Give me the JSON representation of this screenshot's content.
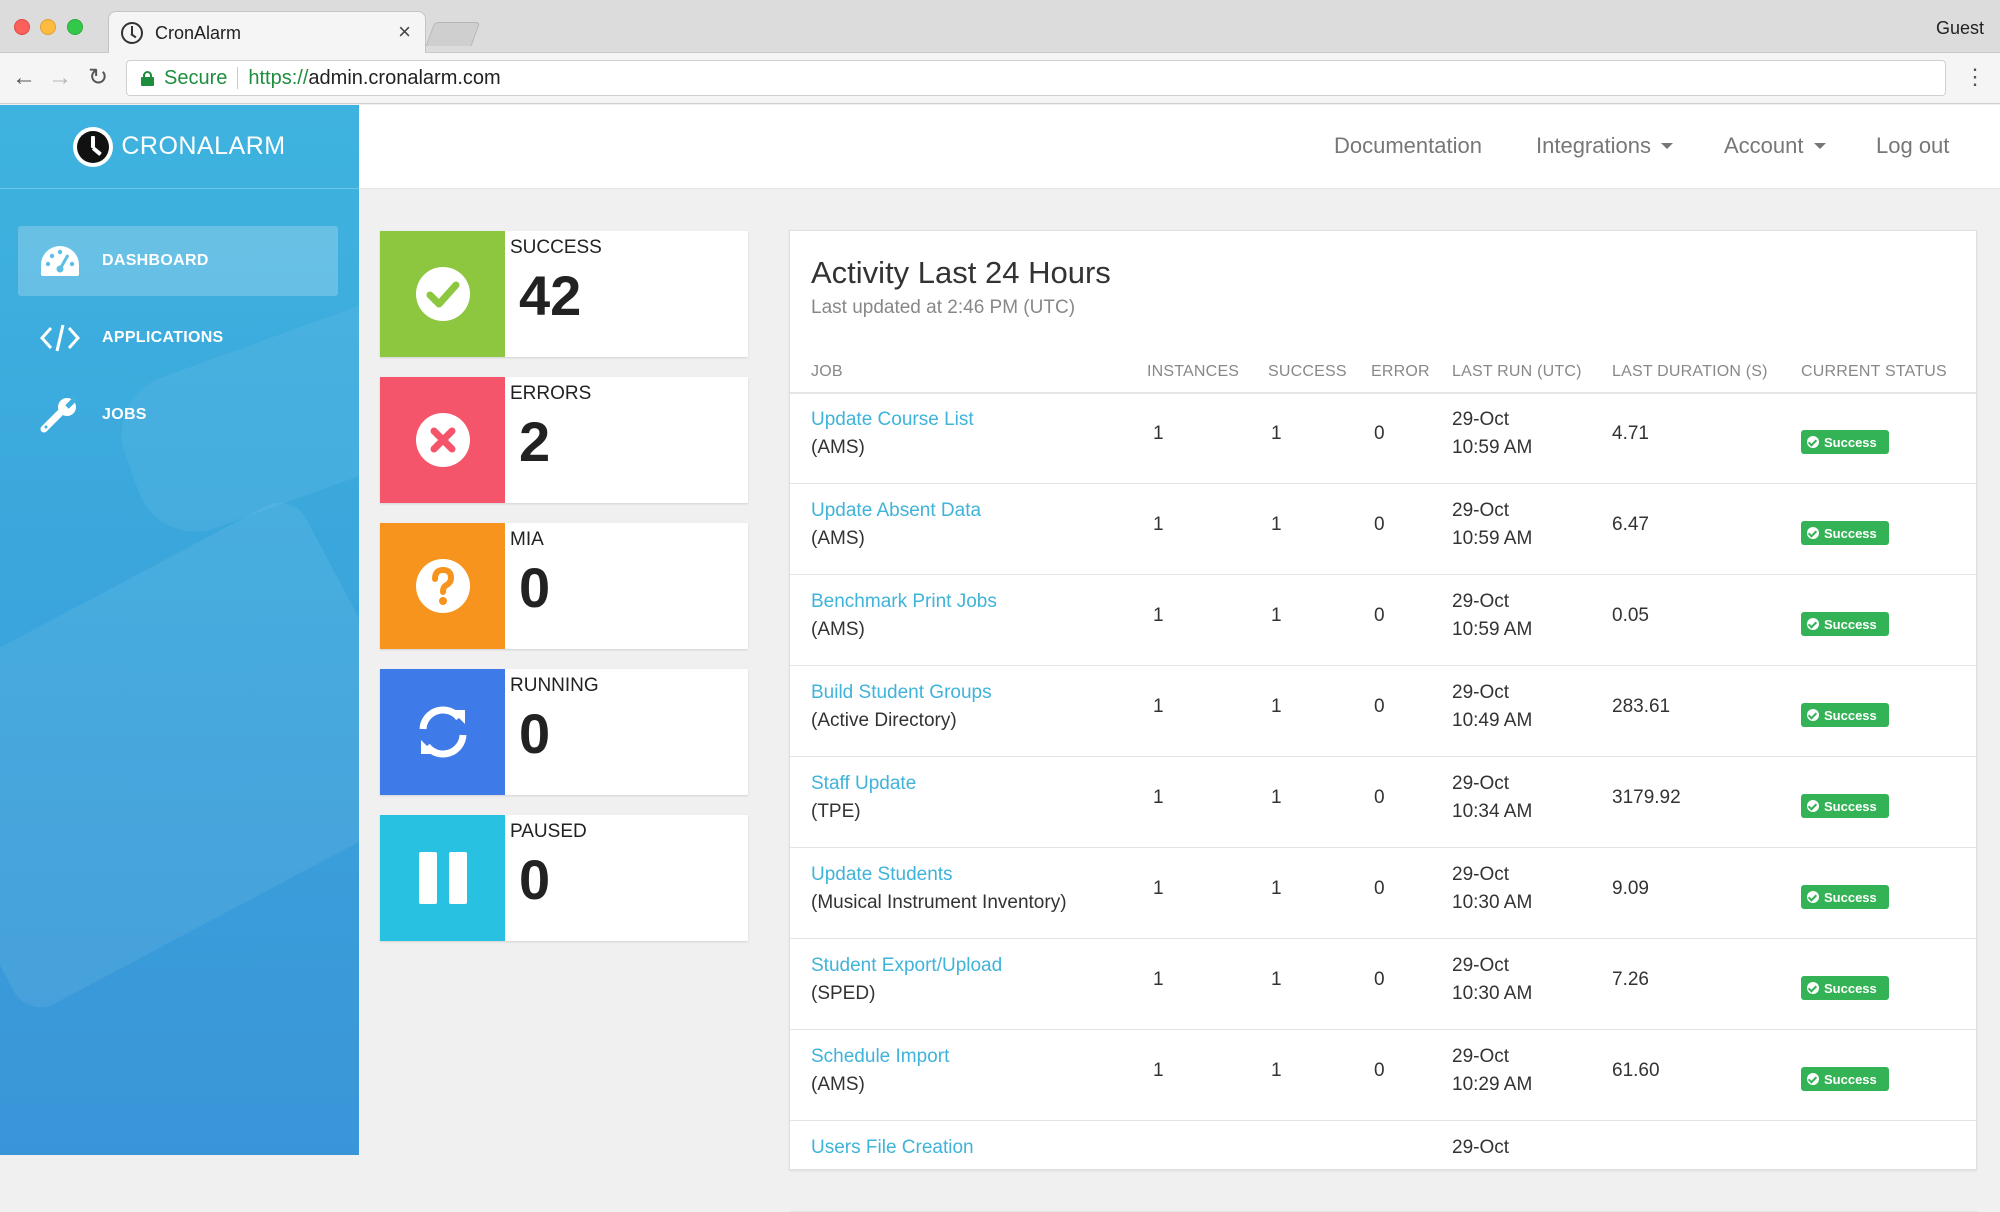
{
  "browser": {
    "tab_title": "CronAlarm",
    "tab_close": "×",
    "profile": "Guest",
    "secure_label": "Secure",
    "url_scheme": "https://",
    "url_host": "admin.cronalarm.com"
  },
  "sidebar": {
    "brand": "CRONALARM",
    "items": [
      {
        "label": "DASHBOARD",
        "icon": "dashboard-icon",
        "active": true
      },
      {
        "label": "APPLICATIONS",
        "icon": "code-icon",
        "active": false
      },
      {
        "label": "JOBS",
        "icon": "wrench-icon",
        "active": false
      }
    ]
  },
  "topnav": {
    "documentation": "Documentation",
    "integrations": "Integrations",
    "account": "Account",
    "logout": "Log out"
  },
  "stats": [
    {
      "label": "SUCCESS",
      "value": "42",
      "color": "#8dc63f",
      "icon": "check-circle-icon"
    },
    {
      "label": "ERRORS",
      "value": "2",
      "color": "#f4556a",
      "icon": "x-circle-icon"
    },
    {
      "label": "MIA",
      "value": "0",
      "color": "#f7941d",
      "icon": "question-circle-icon"
    },
    {
      "label": "RUNNING",
      "value": "0",
      "color": "#3f7be8",
      "icon": "refresh-icon"
    },
    {
      "label": "PAUSED",
      "value": "0",
      "color": "#29c1e1",
      "icon": "pause-icon"
    }
  ],
  "activity": {
    "title": "Activity Last 24 Hours",
    "subtitle": "Last updated at 2:46 PM (UTC)",
    "columns": [
      "JOB",
      "INSTANCES",
      "SUCCESS",
      "ERROR",
      "LAST RUN (UTC)",
      "LAST DURATION (S)",
      "CURRENT STATUS"
    ],
    "rows": [
      {
        "job": "Update Course List",
        "app": "(AMS)",
        "instances": "1",
        "success": "1",
        "error": "0",
        "date": "29-Oct",
        "time": "10:59 AM",
        "duration": "4.71",
        "status": "Success"
      },
      {
        "job": "Update Absent Data",
        "app": "(AMS)",
        "instances": "1",
        "success": "1",
        "error": "0",
        "date": "29-Oct",
        "time": "10:59 AM",
        "duration": "6.47",
        "status": "Success"
      },
      {
        "job": "Benchmark Print Jobs",
        "app": "(AMS)",
        "instances": "1",
        "success": "1",
        "error": "0",
        "date": "29-Oct",
        "time": "10:59 AM",
        "duration": "0.05",
        "status": "Success"
      },
      {
        "job": "Build Student Groups",
        "app": "(Active Directory)",
        "instances": "1",
        "success": "1",
        "error": "0",
        "date": "29-Oct",
        "time": "10:49 AM",
        "duration": "283.61",
        "status": "Success"
      },
      {
        "job": "Staff Update",
        "app": "(TPE)",
        "instances": "1",
        "success": "1",
        "error": "0",
        "date": "29-Oct",
        "time": "10:34 AM",
        "duration": "3179.92",
        "status": "Success"
      },
      {
        "job": "Update Students",
        "app": "(Musical Instrument Inventory)",
        "instances": "1",
        "success": "1",
        "error": "0",
        "date": "29-Oct",
        "time": "10:30 AM",
        "duration": "9.09",
        "status": "Success"
      },
      {
        "job": "Student Export/Upload",
        "app": "(SPED)",
        "instances": "1",
        "success": "1",
        "error": "0",
        "date": "29-Oct",
        "time": "10:30 AM",
        "duration": "7.26",
        "status": "Success"
      },
      {
        "job": "Schedule Import",
        "app": "(AMS)",
        "instances": "1",
        "success": "1",
        "error": "0",
        "date": "29-Oct",
        "time": "10:29 AM",
        "duration": "61.60",
        "status": "Success"
      },
      {
        "job": "Users File Creation",
        "app": "",
        "instances": "",
        "success": "",
        "error": "",
        "date": "29-Oct",
        "time": "",
        "duration": "",
        "status": ""
      }
    ]
  }
}
